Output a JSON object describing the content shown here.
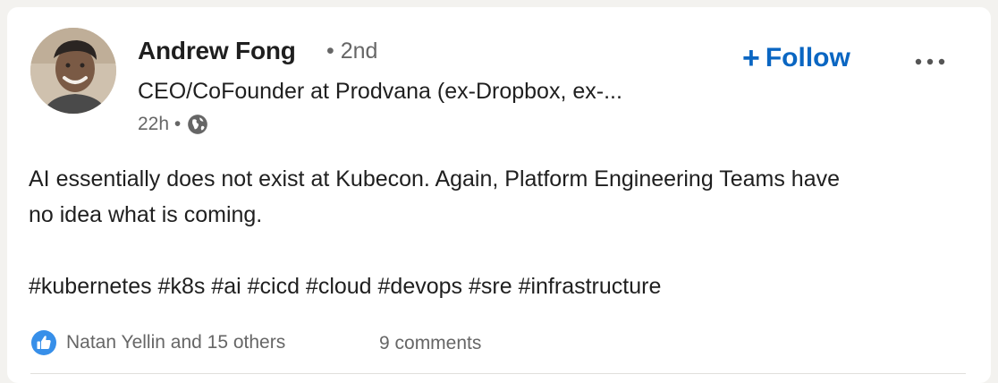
{
  "post": {
    "author": {
      "name": "Andrew Fong",
      "degree": "• 2nd",
      "headline": "CEO/CoFounder at Prodvana (ex-Dropbox, ex-...",
      "time": "22h •",
      "visibility_icon": "globe-icon"
    },
    "actions": {
      "follow_label": "Follow",
      "follow_icon": "plus-icon",
      "more_icon": "ellipsis-icon"
    },
    "body": {
      "line1": "AI essentially does not exist at Kubecon. Again, Platform Engineering Teams have",
      "line2": "no idea what is coming.",
      "hashtags": "#kubernetes #k8s #ai #cicd #cloud #devops #sre #infrastructure"
    },
    "social": {
      "reaction_icon": "like-icon",
      "reactions_text": "Natan Yellin and 15 others",
      "comments_text": "9 comments"
    }
  },
  "colors": {
    "accent": "#0a66c2",
    "text_primary": "#1f1f1f",
    "text_secondary": "#666666"
  }
}
